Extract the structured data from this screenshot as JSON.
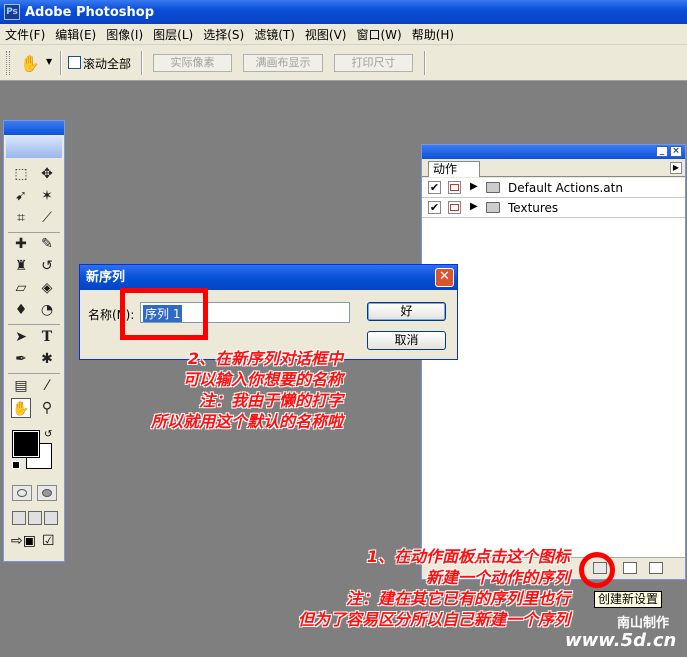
{
  "window": {
    "title": "Adobe Photoshop",
    "app_icon_text": "Ps"
  },
  "menu": [
    "文件(F)",
    "编辑(E)",
    "图像(I)",
    "图层(L)",
    "选择(S)",
    "滤镜(T)",
    "视图(V)",
    "窗口(W)",
    "帮助(H)"
  ],
  "options": {
    "scroll_all_label": "滚动全部",
    "scroll_all_checked": false,
    "actual_pixels": "实际像素",
    "fit_on_screen": "满画布显示",
    "print_size": "打印尺寸"
  },
  "toolbox": {
    "tool_icons": [
      "marquee-icon",
      "move-icon",
      "lasso-icon",
      "magic-wand-icon",
      "crop-icon",
      "slice-icon",
      "healing-brush-icon",
      "brush-icon",
      "clone-stamp-icon",
      "history-brush-icon",
      "eraser-icon",
      "paint-bucket-icon",
      "blur-icon",
      "dodge-icon",
      "path-select-icon",
      "type-icon",
      "pen-icon",
      "shape-icon",
      "notes-icon",
      "eyedropper-icon",
      "hand-icon",
      "zoom-icon"
    ],
    "foreground_color": "#000000",
    "background_color": "#ffffff"
  },
  "actions_panel": {
    "tab_label": "动作",
    "rows": [
      {
        "label": "Default Actions.atn",
        "checked": true
      },
      {
        "label": "Textures",
        "checked": true
      }
    ],
    "tooltip": "创建新设置"
  },
  "dialog": {
    "title": "新序列",
    "name_label": "名称(N):",
    "name_value": "序列 1",
    "ok_label": "好",
    "cancel_label": "取消"
  },
  "annotations": {
    "step2": [
      "2、在新序列对话框中",
      "可以输入你想要的名称",
      "注：我由于懒的打字",
      "所以就用这个默认的名称啦"
    ],
    "step1": [
      "1、在动作面板点击这个图标",
      "新建一个动作的序列",
      "注：建在其它已有的序列里也行",
      "但为了容易区分所以自己新建一个序列"
    ],
    "credit": "南山制作",
    "site": "www.5d.cn"
  },
  "colors": {
    "annotation_red": "#ff0000",
    "titlebar_blue": "#0a4ed8"
  }
}
